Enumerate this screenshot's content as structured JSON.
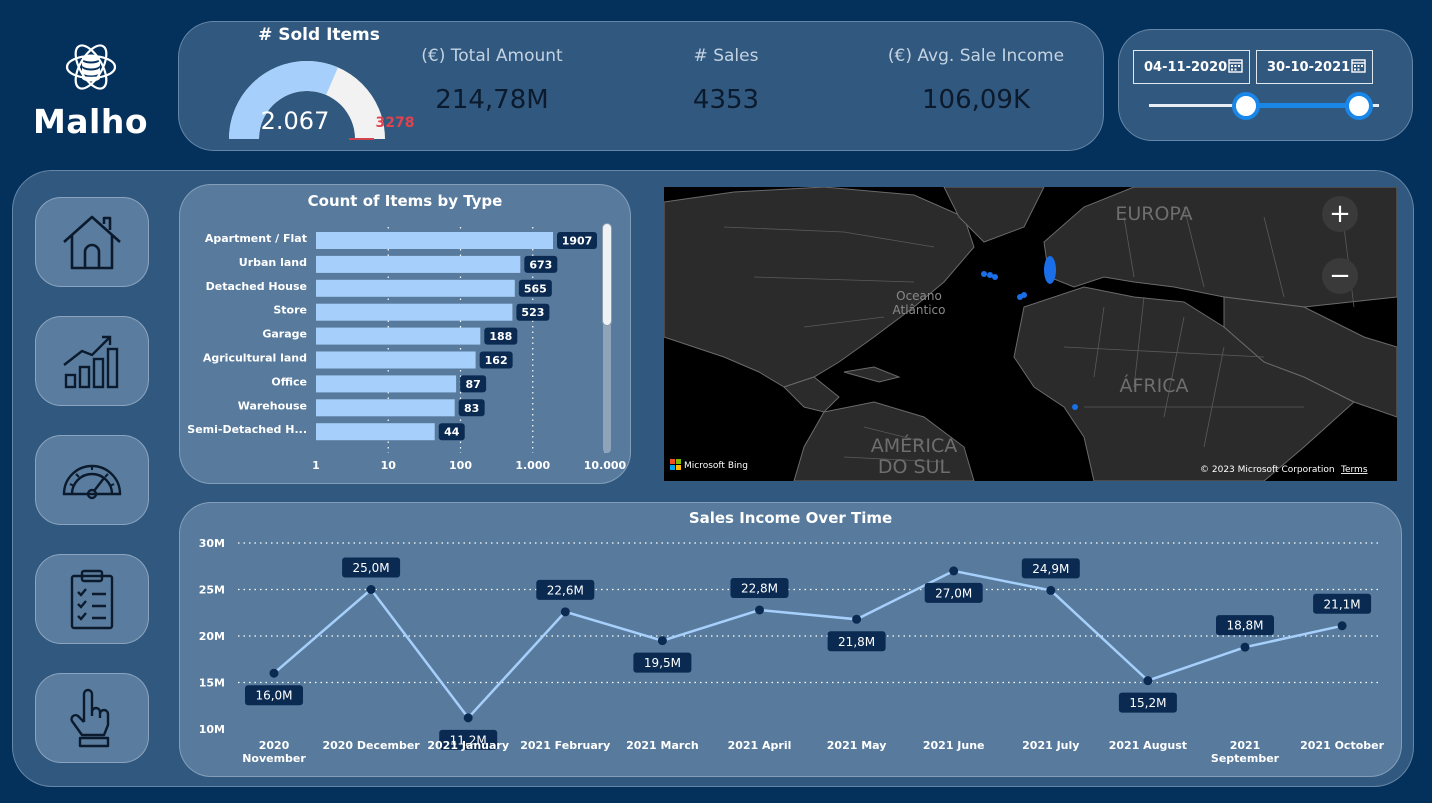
{
  "brand": {
    "name": "Malho",
    "icon": "database-orbit-icon"
  },
  "kpis": {
    "sold_items": {
      "title": "# Sold Items",
      "value": "2.067",
      "target": "3278",
      "fraction": 0.63
    },
    "total_amount": {
      "title": "(€) Total Amount",
      "value": "214,78M"
    },
    "sales": {
      "title": "# Sales",
      "value": "4353"
    },
    "avg_income": {
      "title": "(€) Avg. Sale Income",
      "value": "106,09K"
    }
  },
  "date_range": {
    "start": "04-11-2020",
    "end": "30-10-2021",
    "icon": "calendar-icon"
  },
  "nav": [
    {
      "name": "home",
      "icon": "home-icon"
    },
    {
      "name": "analytics",
      "icon": "bar-growth-icon"
    },
    {
      "name": "performance",
      "icon": "speedometer-icon"
    },
    {
      "name": "checklist",
      "icon": "clipboard-checklist-icon"
    },
    {
      "name": "interact",
      "icon": "pointer-hand-icon"
    }
  ],
  "items_chart": {
    "title": "Count of Items by Type",
    "type": "bar",
    "scale": "log",
    "categories": [
      "Apartment / Flat",
      "Urban land",
      "Detached House",
      "Store",
      "Garage",
      "Agricultural land",
      "Office",
      "Warehouse",
      "Semi-Detached H..."
    ],
    "values": [
      1907,
      673,
      565,
      523,
      188,
      162,
      87,
      83,
      44
    ],
    "ticks": [
      "1",
      "10",
      "100",
      "1.000",
      "10.000"
    ],
    "bar_color": "#a6d0fb"
  },
  "map": {
    "labels": {
      "ocean": "Oceano",
      "ocean2": "Atlântico",
      "europe": "EUROPA",
      "africa": "ÁFRICA",
      "sa1": "AMÉRICA",
      "sa2": "DO SUL"
    },
    "attribution": "Microsoft Bing",
    "copyright": "© 2023 Microsoft Corporation",
    "terms": "Terms",
    "zoom_in": "+",
    "zoom_out": "−"
  },
  "chart_data": {
    "type": "line",
    "title": "Sales Income Over Time",
    "categories": [
      "2020 November",
      "2020 December",
      "2021 January",
      "2021 February",
      "2021 March",
      "2021 April",
      "2021 May",
      "2021 June",
      "2021 July",
      "2021 August",
      "2021 September",
      "2021 October"
    ],
    "values": [
      16.0,
      25.0,
      11.2,
      22.6,
      19.5,
      22.8,
      21.8,
      27.0,
      24.9,
      15.2,
      18.8,
      21.1
    ],
    "data_labels": [
      "16,0M",
      "25,0M",
      "11,2M",
      "22,6M",
      "19,5M",
      "22,8M",
      "21,8M",
      "27,0M",
      "24,9M",
      "15,2M",
      "18,8M",
      "21,1M"
    ],
    "y_ticks": [
      "10M",
      "15M",
      "20M",
      "25M",
      "30M"
    ],
    "ylim": [
      10,
      30
    ],
    "line_color": "#a6d0fb"
  }
}
